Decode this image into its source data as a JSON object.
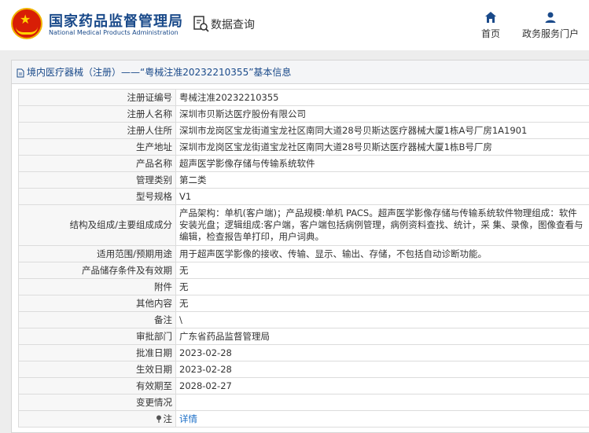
{
  "header": {
    "brand_cn": "国家药品监督管理局",
    "brand_en": "National Medical Products Administration",
    "query_label": "数据查询",
    "nav": {
      "home": "首页",
      "service": "政务服务门户"
    }
  },
  "panel": {
    "title": "境内医疗器械（注册）——“粤械注准20232210355”基本信息"
  },
  "rows": [
    {
      "k": "注册证编号",
      "v": "粤械注准20232210355"
    },
    {
      "k": "注册人名称",
      "v": "深圳市贝斯达医疗股份有限公司"
    },
    {
      "k": "注册人住所",
      "v": "深圳市龙岗区宝龙街道宝龙社区南同大道28号贝斯达医疗器械大厦1栋A号厂房1A1901"
    },
    {
      "k": "生产地址",
      "v": "深圳市龙岗区宝龙街道宝龙社区南同大道28号贝斯达医疗器械大厦1栋B号厂房"
    },
    {
      "k": "产品名称",
      "v": "超声医学影像存储与传输系统软件"
    },
    {
      "k": "管理类别",
      "v": "第二类"
    },
    {
      "k": "型号规格",
      "v": "V1"
    },
    {
      "k": "结构及组成/主要组成成分",
      "v": "产品架构：单机(客户端)；产品规模:单机 PACS。超声医学影像存储与传输系统软件物理组成：软件安装光盘；逻辑组成:客户端，客户端包括病例管理，病例资料查找、统计，采 集、录像，图像查看与编辑，检查报告单打印，用户词典。"
    },
    {
      "k": "适用范围/预期用途",
      "v": "用于超声医学影像的接收、传输、显示、输出、存储，不包括自动诊断功能。"
    },
    {
      "k": "产品储存条件及有效期",
      "v": "无"
    },
    {
      "k": "附件",
      "v": "无"
    },
    {
      "k": "其他内容",
      "v": "无"
    },
    {
      "k": "备注",
      "v": "\\"
    },
    {
      "k": "审批部门",
      "v": "广东省药品监督管理局"
    },
    {
      "k": "批准日期",
      "v": "2023-02-28"
    },
    {
      "k": "生效日期",
      "v": "2023-02-28"
    },
    {
      "k": "有效期至",
      "v": "2028-02-27"
    },
    {
      "k": "变更情况",
      "v": ""
    },
    {
      "k": "注",
      "v": "详情"
    }
  ],
  "colors": {
    "brand_blue": "#1a4a8a",
    "link_blue": "#1a6ec7",
    "logo_red": "#d81e06",
    "logo_gold": "#f0b400"
  },
  "icons": {
    "logo": "national-emblem-icon",
    "query": "document-search-icon",
    "home": "home-icon",
    "service": "user-icon",
    "title": "document-icon",
    "note": "pin-icon"
  }
}
